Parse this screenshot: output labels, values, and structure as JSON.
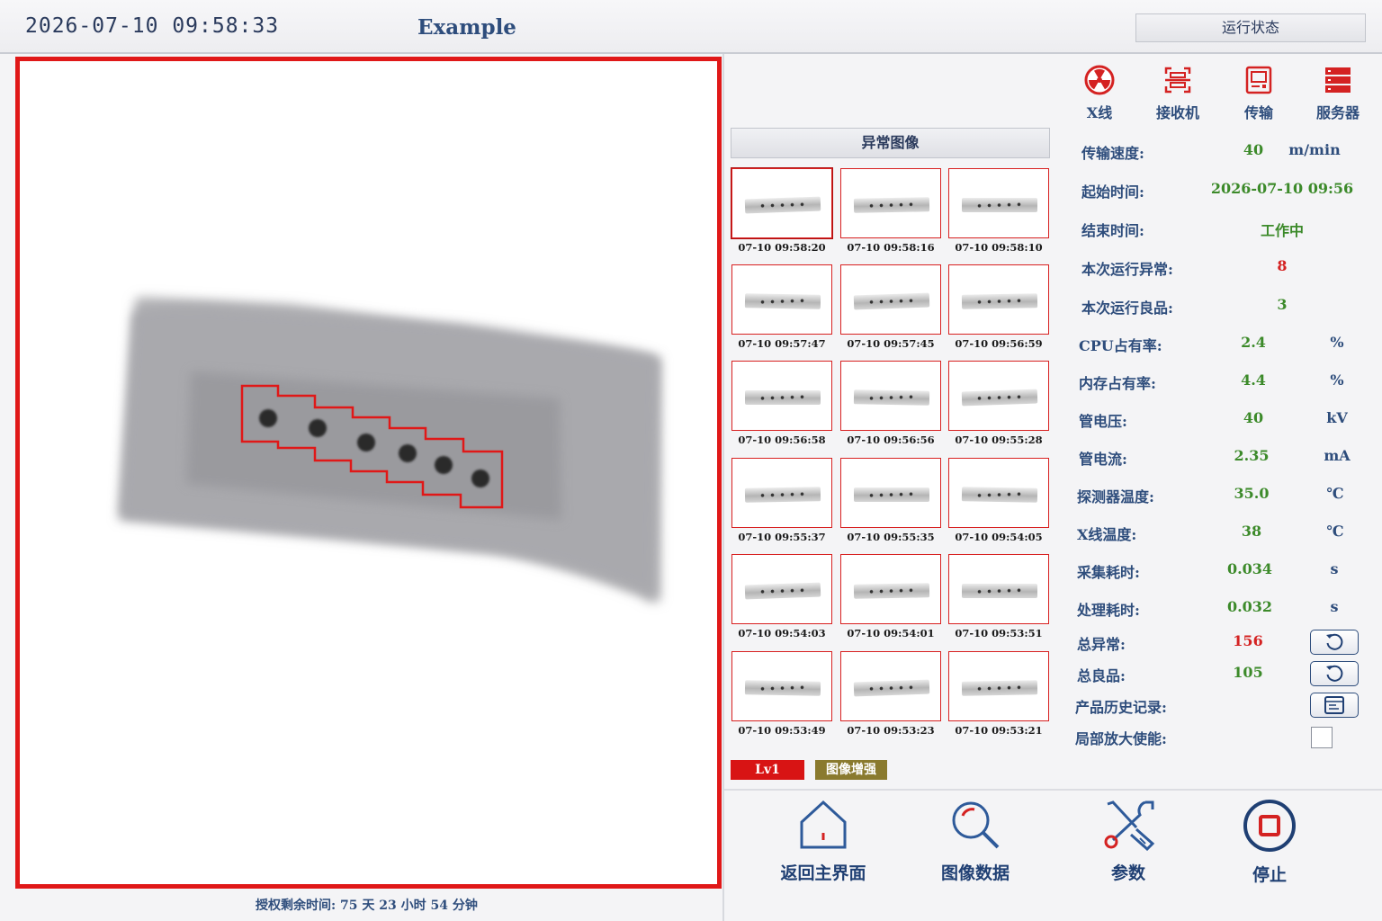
{
  "header": {
    "datetime": "2026-07-10  09:58:33",
    "title": "Example",
    "status_button": "运行状态"
  },
  "footer": {
    "license": "授权剩余时间:  75 天 23 小时 54 分钟"
  },
  "gallery": {
    "header": "异常图像",
    "thumbnails": [
      {
        "time": "07-10 09:58:20"
      },
      {
        "time": "07-10 09:58:16"
      },
      {
        "time": "07-10 09:58:10"
      },
      {
        "time": "07-10 09:57:47"
      },
      {
        "time": "07-10 09:57:45"
      },
      {
        "time": "07-10 09:56:59"
      },
      {
        "time": "07-10 09:56:58"
      },
      {
        "time": "07-10 09:56:56"
      },
      {
        "time": "07-10 09:55:28"
      },
      {
        "time": "07-10 09:55:37"
      },
      {
        "time": "07-10 09:55:35"
      },
      {
        "time": "07-10 09:54:05"
      },
      {
        "time": "07-10 09:54:03"
      },
      {
        "time": "07-10 09:54:01"
      },
      {
        "time": "07-10 09:53:51"
      },
      {
        "time": "07-10 09:53:49"
      },
      {
        "time": "07-10 09:53:23"
      },
      {
        "time": "07-10 09:53:21"
      }
    ]
  },
  "badges": {
    "level": "Lv1",
    "enhance": "图像增强"
  },
  "status_icons": {
    "xray": "X线",
    "receiver": "接收机",
    "transport": "传输",
    "server": "服务器"
  },
  "stats": {
    "speed": {
      "label": "传输速度:",
      "value": "40",
      "unit": "m/min"
    },
    "start": {
      "label": "起始时间:",
      "value": "2026-07-10 09:56"
    },
    "end": {
      "label": "结束时间:",
      "value": "工作中"
    },
    "run_abnormal": {
      "label": "本次运行异常:",
      "value": "8"
    },
    "run_good": {
      "label": "本次运行良品:",
      "value": "3"
    },
    "cpu": {
      "label": "CPU占有率:",
      "value": "2.4",
      "unit": "%"
    },
    "mem": {
      "label": "内存占有率:",
      "value": "4.4",
      "unit": "%"
    },
    "voltage": {
      "label": "管电压:",
      "value": "40",
      "unit": "kV"
    },
    "current": {
      "label": "管电流:",
      "value": "2.35",
      "unit": "mA"
    },
    "det_temp": {
      "label": "探测器温度:",
      "value": "35.0",
      "unit": "℃"
    },
    "xray_temp": {
      "label": "X线温度:",
      "value": "38",
      "unit": "℃"
    },
    "acq_time": {
      "label": "采集耗时:",
      "value": "0.034",
      "unit": "s"
    },
    "proc_time": {
      "label": "处理耗时:",
      "value": "0.032",
      "unit": "s"
    },
    "total_abnormal": {
      "label": "总异常:",
      "value": "156"
    },
    "total_good": {
      "label": "总良品:",
      "value": "105"
    },
    "history": {
      "label": "产品历史记录:"
    },
    "zoom": {
      "label": "局部放大使能:"
    }
  },
  "nav": {
    "home": "返回主界面",
    "image_data": "图像数据",
    "params": "参数",
    "stop": "停止"
  },
  "colors": {
    "accent": "#2e4d7c",
    "alarm": "#d42222",
    "ok": "#3c8a2a"
  }
}
